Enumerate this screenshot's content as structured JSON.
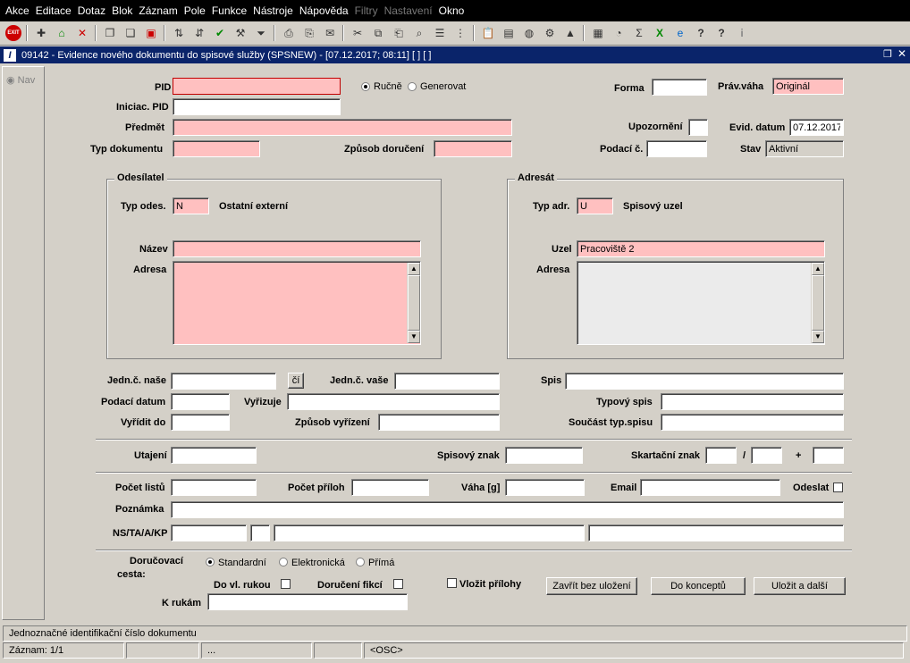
{
  "menu": [
    "Akce",
    "Editace",
    "Dotaz",
    "Blok",
    "Záznam",
    "Pole",
    "Funkce",
    "Nástroje",
    "Nápověda",
    "Filtry",
    "Nastavení",
    "Okno"
  ],
  "menu_disabled": [
    "Filtry",
    "Nastavení"
  ],
  "window": {
    "title": "09142 - Evidence nového dokumentu do spisové služby (SPSNEW) - [07.12.2017; 08:11]  [ ]  [ ]",
    "nav_label": "Nav"
  },
  "form": {
    "pid_label": "PID",
    "pid_value": "",
    "radio_rucne": "Ručně",
    "radio_generovat": "Generovat",
    "forma_label": "Forma",
    "forma_value": "",
    "prav_vaha_label": "Práv.váha",
    "prav_vaha_value": "Originál",
    "iniciac_pid_label": "Iniciac. PID",
    "iniciac_pid_value": "",
    "predmet_label": "Předmět",
    "predmet_value": "",
    "upozorneni_label": "Upozornění",
    "evid_datum_label": "Evid. datum",
    "evid_datum_value": "07.12.2017",
    "typ_dokumentu_label": "Typ dokumentu",
    "typ_dokumentu_value": "",
    "zpusob_doruceni_label": "Způsob doručení",
    "zpusob_doruceni_value": "",
    "podaci_c_label": "Podací č.",
    "podaci_c_value": "",
    "stav_label": "Stav",
    "stav_value": "Aktivní"
  },
  "odesilatel": {
    "title": "Odesílatel",
    "typ_label": "Typ odes.",
    "typ_value": "N",
    "typ_desc": "Ostatní externí",
    "nazev_label": "Název",
    "nazev_value": "",
    "adresa_label": "Adresa",
    "adresa_value": ""
  },
  "adresat": {
    "title": "Adresát",
    "typ_label": "Typ adr.",
    "typ_value": "U",
    "typ_desc": "Spisový uzel",
    "uzel_label": "Uzel",
    "uzel_value": "Pracoviště 2",
    "adresa_label": "Adresa",
    "adresa_value": ""
  },
  "detail": {
    "jedn_nase_label": "Jedn.č. naše",
    "ci_button": "čí",
    "jedn_vase_label": "Jedn.č. vaše",
    "spis_label": "Spis",
    "podaci_datum_label": "Podací datum",
    "vyrizuje_label": "Vyřizuje",
    "typovy_spis_label": "Typový spis",
    "vyridit_do_label": "Vyřídit do",
    "zpusob_vyrizeni_label": "Způsob vyřízení",
    "soucast_label": "Součást typ.spisu",
    "utajeni_label": "Utajení",
    "spisovy_znak_label": "Spisový znak",
    "skartacni_znak_label": "Skartační znak",
    "slash": "/",
    "plus": "+",
    "pocet_listu_label": "Počet listů",
    "pocet_priloh_label": "Počet příloh",
    "vaha_label": "Váha [g]",
    "email_label": "Email",
    "odeslat_label": "Odeslat",
    "poznamka_label": "Poznámka",
    "ns_label": "NS/TA/A/KP"
  },
  "delivery": {
    "label_line1": "Doručovací",
    "label_line2": "cesta:",
    "opt_standard": "Standardní",
    "opt_elektronicka": "Elektronická",
    "opt_prima": "Přímá",
    "do_vl_rukou": "Do vl. rukou",
    "doruceni_fikci": "Doručení fikcí",
    "vlozit_prilohy": "Vložit přílohy",
    "k_rukam_label": "K rukám",
    "btn_zavrit": "Zavřít bez uložení",
    "btn_koncept": "Do konceptů",
    "btn_ulozit": "Uložit a další"
  },
  "status": {
    "hint": "Jednoznačné identifikační číslo dokumentu",
    "record": "Záznam: 1/1",
    "dots": "...",
    "osc": "<OSC>"
  },
  "colors": {
    "required_field": "#ffc0c0",
    "title_bar": "#0a246a",
    "menu_bar": "#000000"
  }
}
